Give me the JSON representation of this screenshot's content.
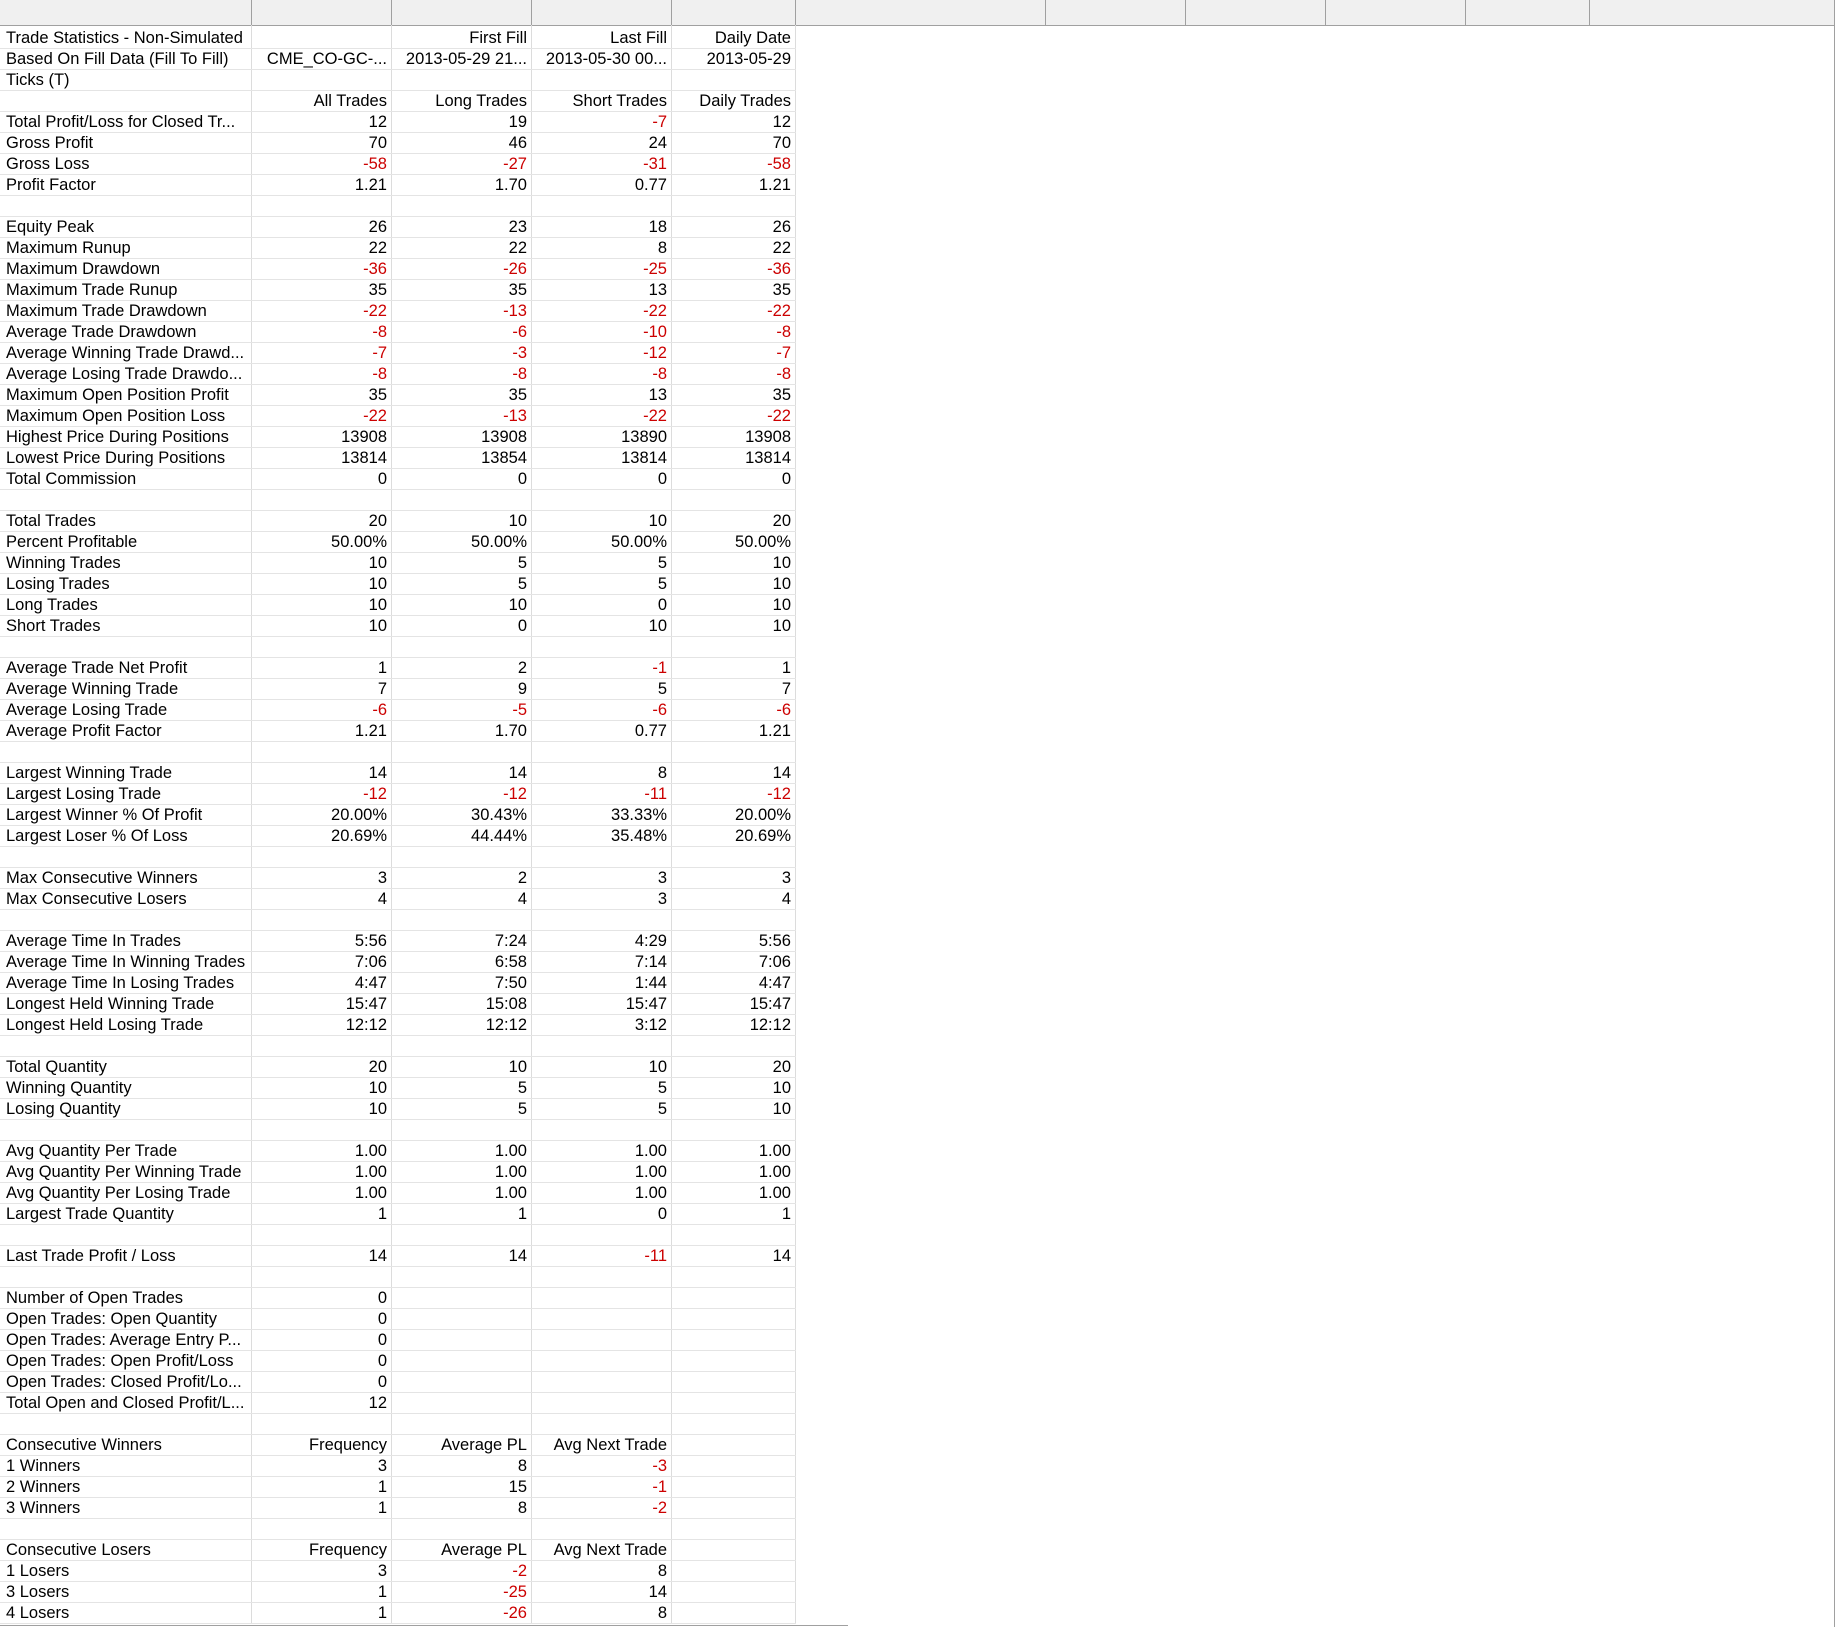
{
  "rows": [
    [
      "Trade Statistics - Non-Simulated",
      "",
      "First Fill",
      "Last Fill",
      "Daily Date"
    ],
    [
      "Based On Fill Data (Fill To Fill)",
      "CME_CO-GC-...",
      "2013-05-29  21...",
      "2013-05-30  00...",
      "2013-05-29"
    ],
    [
      "Ticks (T)",
      "",
      "",
      "",
      ""
    ],
    [
      "",
      "All Trades",
      "Long Trades",
      "Short Trades",
      "Daily Trades"
    ],
    [
      "Total Profit/Loss for Closed Tr...",
      "12",
      "19",
      "-7",
      "12"
    ],
    [
      "Gross Profit",
      "70",
      "46",
      "24",
      "70"
    ],
    [
      "Gross Loss",
      "-58",
      "-27",
      "-31",
      "-58"
    ],
    [
      "Profit Factor",
      "1.21",
      "1.70",
      "0.77",
      "1.21"
    ],
    [
      "",
      "",
      "",
      "",
      ""
    ],
    [
      "Equity Peak",
      "26",
      "23",
      "18",
      "26"
    ],
    [
      "Maximum Runup",
      "22",
      "22",
      "8",
      "22"
    ],
    [
      "Maximum Drawdown",
      "-36",
      "-26",
      "-25",
      "-36"
    ],
    [
      "Maximum Trade Runup",
      "35",
      "35",
      "13",
      "35"
    ],
    [
      "Maximum Trade Drawdown",
      "-22",
      "-13",
      "-22",
      "-22"
    ],
    [
      "Average Trade Drawdown",
      "-8",
      "-6",
      "-10",
      "-8"
    ],
    [
      "Average Winning Trade Drawd...",
      "-7",
      "-3",
      "-12",
      "-7"
    ],
    [
      "Average Losing Trade Drawdo...",
      "-8",
      "-8",
      "-8",
      "-8"
    ],
    [
      "Maximum Open Position Profit",
      "35",
      "35",
      "13",
      "35"
    ],
    [
      "Maximum Open Position Loss",
      "-22",
      "-13",
      "-22",
      "-22"
    ],
    [
      "Highest Price During Positions",
      "13908",
      "13908",
      "13890",
      "13908"
    ],
    [
      "Lowest Price During Positions",
      "13814",
      "13854",
      "13814",
      "13814"
    ],
    [
      "Total Commission",
      "0",
      "0",
      "0",
      "0"
    ],
    [
      "",
      "",
      "",
      "",
      ""
    ],
    [
      "Total Trades",
      "20",
      "10",
      "10",
      "20"
    ],
    [
      "Percent Profitable",
      "50.00%",
      "50.00%",
      "50.00%",
      "50.00%"
    ],
    [
      "Winning Trades",
      "10",
      "5",
      "5",
      "10"
    ],
    [
      "Losing Trades",
      "10",
      "5",
      "5",
      "10"
    ],
    [
      "Long Trades",
      "10",
      "10",
      "0",
      "10"
    ],
    [
      "Short Trades",
      "10",
      "0",
      "10",
      "10"
    ],
    [
      "",
      "",
      "",
      "",
      ""
    ],
    [
      "Average Trade Net Profit",
      "1",
      "2",
      "-1",
      "1"
    ],
    [
      "Average Winning Trade",
      "7",
      "9",
      "5",
      "7"
    ],
    [
      "Average Losing Trade",
      "-6",
      "-5",
      "-6",
      "-6"
    ],
    [
      "Average Profit Factor",
      "1.21",
      "1.70",
      "0.77",
      "1.21"
    ],
    [
      "",
      "",
      "",
      "",
      ""
    ],
    [
      "Largest Winning Trade",
      "14",
      "14",
      "8",
      "14"
    ],
    [
      "Largest Losing Trade",
      "-12",
      "-12",
      "-11",
      "-12"
    ],
    [
      "Largest Winner % Of Profit",
      "20.00%",
      "30.43%",
      "33.33%",
      "20.00%"
    ],
    [
      "Largest Loser % Of Loss",
      "20.69%",
      "44.44%",
      "35.48%",
      "20.69%"
    ],
    [
      "",
      "",
      "",
      "",
      ""
    ],
    [
      "Max Consecutive Winners",
      "3",
      "2",
      "3",
      "3"
    ],
    [
      "Max Consecutive Losers",
      "4",
      "4",
      "3",
      "4"
    ],
    [
      "",
      "",
      "",
      "",
      ""
    ],
    [
      "Average Time In Trades",
      "5:56",
      "7:24",
      "4:29",
      "5:56"
    ],
    [
      "Average Time In Winning Trades",
      "7:06",
      "6:58",
      "7:14",
      "7:06"
    ],
    [
      "Average Time In Losing Trades",
      "4:47",
      "7:50",
      "1:44",
      "4:47"
    ],
    [
      "Longest Held Winning Trade",
      "15:47",
      "15:08",
      "15:47",
      "15:47"
    ],
    [
      "Longest Held Losing Trade",
      "12:12",
      "12:12",
      "3:12",
      "12:12"
    ],
    [
      "",
      "",
      "",
      "",
      ""
    ],
    [
      "Total Quantity",
      "20",
      "10",
      "10",
      "20"
    ],
    [
      "Winning Quantity",
      "10",
      "5",
      "5",
      "10"
    ],
    [
      "Losing Quantity",
      "10",
      "5",
      "5",
      "10"
    ],
    [
      "",
      "",
      "",
      "",
      ""
    ],
    [
      "Avg Quantity Per Trade",
      "1.00",
      "1.00",
      "1.00",
      "1.00"
    ],
    [
      "Avg Quantity Per Winning Trade",
      "1.00",
      "1.00",
      "1.00",
      "1.00"
    ],
    [
      "Avg Quantity Per Losing Trade",
      "1.00",
      "1.00",
      "1.00",
      "1.00"
    ],
    [
      "Largest Trade Quantity",
      "1",
      "1",
      "0",
      "1"
    ],
    [
      "",
      "",
      "",
      "",
      ""
    ],
    [
      "Last Trade Profit / Loss",
      "14",
      "14",
      "-11",
      "14"
    ],
    [
      "",
      "",
      "",
      "",
      ""
    ],
    [
      "Number of Open Trades",
      "0",
      "",
      "",
      ""
    ],
    [
      "Open Trades: Open Quantity",
      "0",
      "",
      "",
      ""
    ],
    [
      "Open Trades: Average Entry P...",
      "0",
      "",
      "",
      ""
    ],
    [
      "Open Trades: Open Profit/Loss",
      "0",
      "",
      "",
      ""
    ],
    [
      "Open Trades: Closed Profit/Lo...",
      "0",
      "",
      "",
      ""
    ],
    [
      "Total Open and Closed Profit/L...",
      "12",
      "",
      "",
      ""
    ],
    [
      "",
      "",
      "",
      "",
      ""
    ],
    [
      "Consecutive Winners",
      "Frequency",
      "Average PL",
      "Avg Next Trade",
      ""
    ],
    [
      "1 Winners",
      "3",
      "8",
      "-3",
      ""
    ],
    [
      "2 Winners",
      "1",
      "15",
      "-1",
      ""
    ],
    [
      "3 Winners",
      "1",
      "8",
      "-2",
      ""
    ],
    [
      "",
      "",
      "",
      "",
      ""
    ],
    [
      "Consecutive Losers",
      "Frequency",
      "Average PL",
      "Avg Next Trade",
      ""
    ],
    [
      "1 Losers",
      "3",
      "-2",
      "8",
      ""
    ],
    [
      "3 Losers",
      "1",
      "-25",
      "14",
      ""
    ],
    [
      "4 Losers",
      "1",
      "-26",
      "8",
      ""
    ]
  ],
  "colors": {
    "negative": "#cc0000",
    "header_bg": "#f0f0f0",
    "grid": "#dcdcdc"
  }
}
